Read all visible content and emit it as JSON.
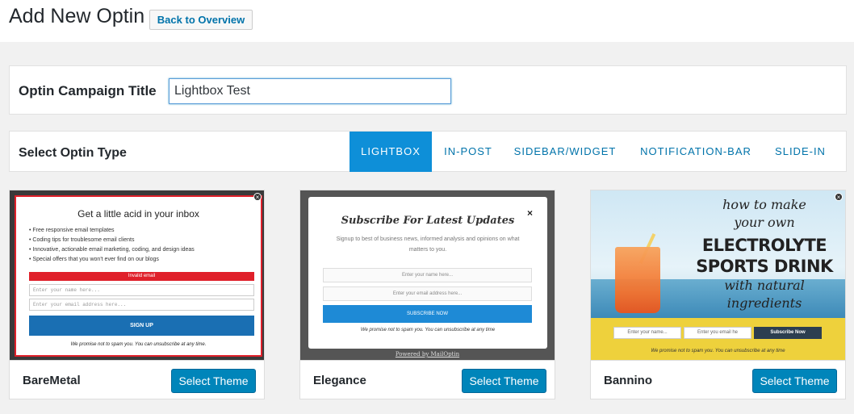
{
  "header": {
    "title": "Add New Optin",
    "back_label": "Back to Overview"
  },
  "campaign": {
    "label": "Optin Campaign Title",
    "value": "Lightbox Test"
  },
  "optin_type": {
    "label": "Select Optin Type",
    "tabs": [
      {
        "label": "LIGHTBOX",
        "active": true
      },
      {
        "label": "IN-POST",
        "active": false
      },
      {
        "label": "SIDEBAR/WIDGET",
        "active": false
      },
      {
        "label": "NOTIFICATION-BAR",
        "active": false
      },
      {
        "label": "SLIDE-IN",
        "active": false
      }
    ]
  },
  "themes": [
    {
      "name": "BareMetal",
      "button": "Select Theme",
      "preview": {
        "title": "Get a little acid in your inbox",
        "bullets": [
          "Free responsive email templates",
          "Coding tips for troublesome email clients",
          "Innovative, actionable email marketing, coding, and design ideas",
          "Special offers that you won't ever find on our blogs"
        ],
        "error": "Invalid email",
        "name_placeholder": "Enter your name here...",
        "email_placeholder": "Enter your email address here...",
        "cta": "SIGN UP",
        "note": "We promise not to spam you. You can unsubscribe at any time."
      }
    },
    {
      "name": "Elegance",
      "button": "Select Theme",
      "preview": {
        "title": "Subscribe For Latest Updates",
        "subtitle": "Signup to best of business news, informed analysis and opinions on what matters to you.",
        "name_placeholder": "Enter your name here...",
        "email_placeholder": "Enter your email address here...",
        "cta": "SUBSCRIBE NOW",
        "note": "We promise not to spam you. You can unsubscribe at any time",
        "powered": "Powered by MailOptin"
      }
    },
    {
      "name": "Bannino",
      "button": "Select Theme",
      "preview": {
        "lines": [
          "how to make",
          "your own",
          "ELECTROLYTE",
          "SPORTS DRINK",
          "with natural",
          "ingredients"
        ],
        "name_placeholder": "Enter your name...",
        "email_placeholder": "Enter you email he",
        "cta": "Subscribe Now",
        "note": "We promise not to spam you. You can unsubscribe at any time"
      }
    }
  ],
  "colors": {
    "accent": "#0e8fd8",
    "button": "#0085ba",
    "link": "#0073aa"
  }
}
